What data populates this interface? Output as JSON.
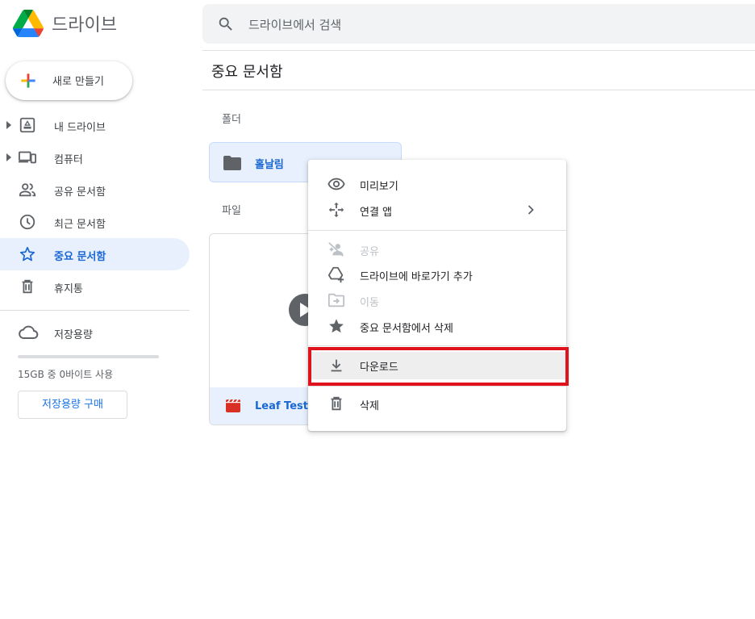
{
  "header": {
    "brand": "드라이브",
    "search_placeholder": "드라이브에서 검색"
  },
  "sidebar": {
    "new_button": "새로 만들기",
    "items": [
      {
        "label": "내 드라이브",
        "icon": "my-drive-icon"
      },
      {
        "label": "컴퓨터",
        "icon": "computers-icon"
      },
      {
        "label": "공유 문서함",
        "icon": "shared-icon"
      },
      {
        "label": "최근 문서함",
        "icon": "clock-icon"
      },
      {
        "label": "중요 문서함",
        "icon": "star-icon",
        "active": true
      },
      {
        "label": "휴지통",
        "icon": "trash-icon"
      }
    ],
    "storage": {
      "label": "저장용량",
      "usage_text": "15GB 중 0바이트 사용",
      "used_fraction": 0.0,
      "buy_button": "저장용량 구매"
    }
  },
  "main": {
    "title": "중요 문서함",
    "folders_label": "폴더",
    "files_label": "파일",
    "folder": {
      "name": "홀날림"
    },
    "file": {
      "name": "Leaf Test.m"
    }
  },
  "context_menu": {
    "items": [
      {
        "label": "미리보기",
        "icon": "eye-icon"
      },
      {
        "label": "연결 앱",
        "icon": "open-with-icon",
        "submenu": true
      },
      {
        "label": "공유",
        "icon": "share-person-icon",
        "disabled": true
      },
      {
        "label": "드라이브에 바로가기 추가",
        "icon": "add-shortcut-icon"
      },
      {
        "label": "이동",
        "icon": "move-folder-icon",
        "disabled": true
      },
      {
        "label": "중요 문서함에서 삭제",
        "icon": "star-filled-icon"
      },
      {
        "label": "다운로드",
        "icon": "download-icon",
        "highlighted": true
      },
      {
        "label": "삭제",
        "icon": "trash-icon"
      }
    ]
  },
  "colors": {
    "accent": "#1a73e8",
    "active_bg": "#e8f0fe",
    "highlight_border": "#e0121b"
  }
}
